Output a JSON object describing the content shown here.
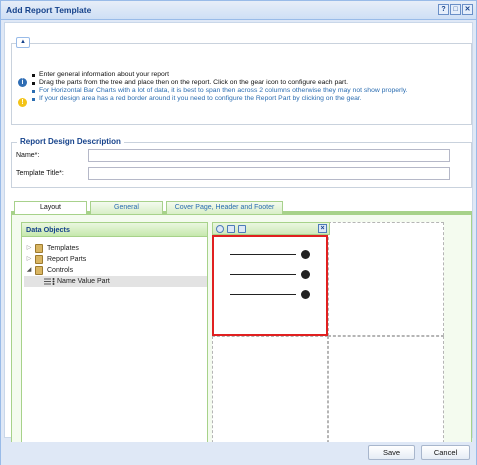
{
  "window": {
    "title": "Add Report Template",
    "tools": [
      "?",
      "□",
      "✕"
    ]
  },
  "info": {
    "lines": [
      {
        "text": "Enter general information about your report",
        "color": "#111111"
      },
      {
        "text": "Drag the parts from the tree and place then on the report. Click on the gear icon to configure each part.",
        "color": "#111111"
      },
      {
        "text": "For Horizontal Bar Charts with a lot of data, it is best to span then across 2 columns otherwise they may not show properly.",
        "color": "#2b6db1"
      },
      {
        "text": "If your design area has a red border around it you need to configure the Report Part by clicking on the gear.",
        "color": "#2b6db1"
      }
    ],
    "info_icon": "info-circle-icon",
    "warn_icon": "warning-circle-icon"
  },
  "description": {
    "legend": "Report Design Description",
    "name_label": "Name*:",
    "name_value": "",
    "title_label": "Template Title*:",
    "title_value": ""
  },
  "tabs": [
    {
      "label": "Layout",
      "active": true
    },
    {
      "label": "General",
      "active": false
    },
    {
      "label": "Cover Page, Header and Footer",
      "active": false
    }
  ],
  "data_objects": {
    "header": "Data Objects",
    "tree": [
      {
        "label": "Templates",
        "expanded": false,
        "icon": "book-icon"
      },
      {
        "label": "Report Parts",
        "expanded": false,
        "icon": "book-icon"
      },
      {
        "label": "Controls",
        "expanded": true,
        "icon": "book-icon"
      },
      {
        "label": "Name Value Part",
        "child": true,
        "selected": true,
        "icon": "name-value-part-icon"
      }
    ]
  },
  "colors": {
    "accent": "#15428b",
    "panel_green": "#a7d28a",
    "invalid_border": "#e02020"
  },
  "footer": {
    "save_label": "Save",
    "cancel_label": "Cancel"
  }
}
